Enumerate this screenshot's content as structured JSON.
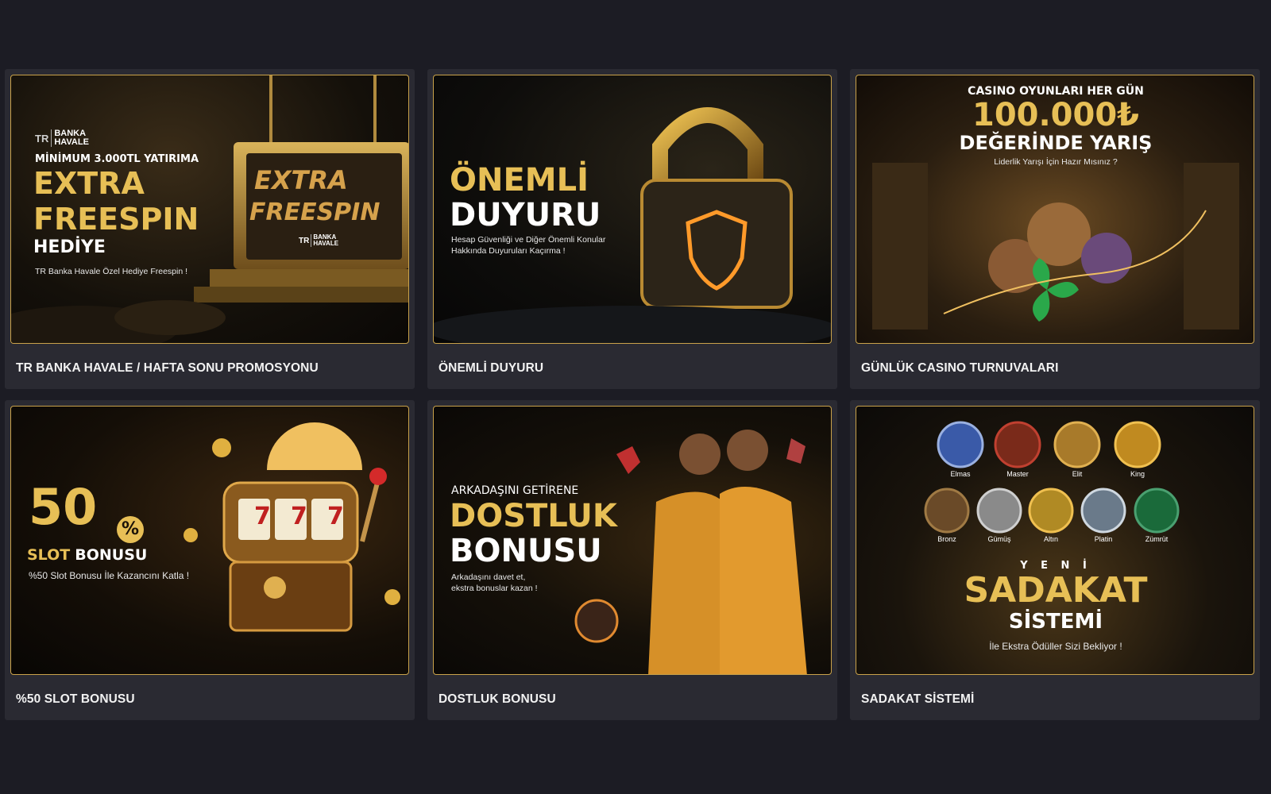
{
  "colors": {
    "page_bg": "#1c1c24",
    "card_bg": "#2a2a32",
    "gold": "#e7bf56",
    "gold_border": "#c9a24a"
  },
  "promotions": [
    {
      "caption": "TR BANKA HAVALE / HAFTA SONU PROMOSYONU",
      "banner": {
        "logo_tr": "TR",
        "logo_text_1": "BANKA",
        "logo_text_2": "HAVALE",
        "subtitle": "MİNİMUM 3.000TL YATIRIMA",
        "title_1": "EXTRA",
        "title_2": "FREESPIN",
        "title_3": "HEDİYE",
        "note": "TR Banka Havale Özel Hediye Freespin !",
        "sign_1": "EXTRA",
        "sign_2": "FREESPIN",
        "sign_logo_tr": "TR",
        "sign_logo_1": "BANKA",
        "sign_logo_2": "HAVALE"
      }
    },
    {
      "caption": "ÖNEMLİ DUYURU",
      "banner": {
        "title_1": "ÖNEMLİ",
        "title_2": "DUYURU",
        "note_1": "Hesap Güvenliği ve Diğer Önemli Konular",
        "note_2": "Hakkında Duyuruları Kaçırma !",
        "icon": "padlock-shield-icon"
      }
    },
    {
      "caption": "GÜNLÜK CASINO TURNUVALARI",
      "banner": {
        "line_1": "CASINO OYUNLARI HER GÜN",
        "amount": "100.000₺",
        "line_2": "DEĞERİNDE YARIŞ",
        "note": "Liderlik Yarışı İçin Hazır Mısınız ?"
      }
    },
    {
      "caption": "%50 SLOT BONUSU",
      "banner": {
        "number": "50",
        "percent": "%",
        "title_gold": "SLOT",
        "title_white": "BONUSU",
        "note": "%50 Slot Bonusu İle Kazancını Katla !",
        "reels": [
          "7",
          "7",
          "7"
        ],
        "icon": "slot-machine-icon"
      }
    },
    {
      "caption": "DOSTLUK BONUSU",
      "banner": {
        "kicker": "ARKADAŞINI GETİRENE",
        "title_1": "DOSTLUK",
        "title_2": "BONUSU",
        "note_1": "Arkadaşını davet et,",
        "note_2": "ekstra bonuslar kazan !"
      }
    },
    {
      "caption": "SADAKAT SİSTEMİ",
      "banner": {
        "tiers_row_1": [
          "Elmas",
          "Master",
          "Elit",
          "King"
        ],
        "tiers_row_2": [
          "Bronz",
          "Gümüş",
          "Altın",
          "Platin",
          "Zümrüt"
        ],
        "kicker": "Y E N İ",
        "title_1": "SADAKAT",
        "title_2": "SİSTEMİ",
        "note": "İle Ekstra Ödüller Sizi Bekliyor !"
      }
    }
  ]
}
